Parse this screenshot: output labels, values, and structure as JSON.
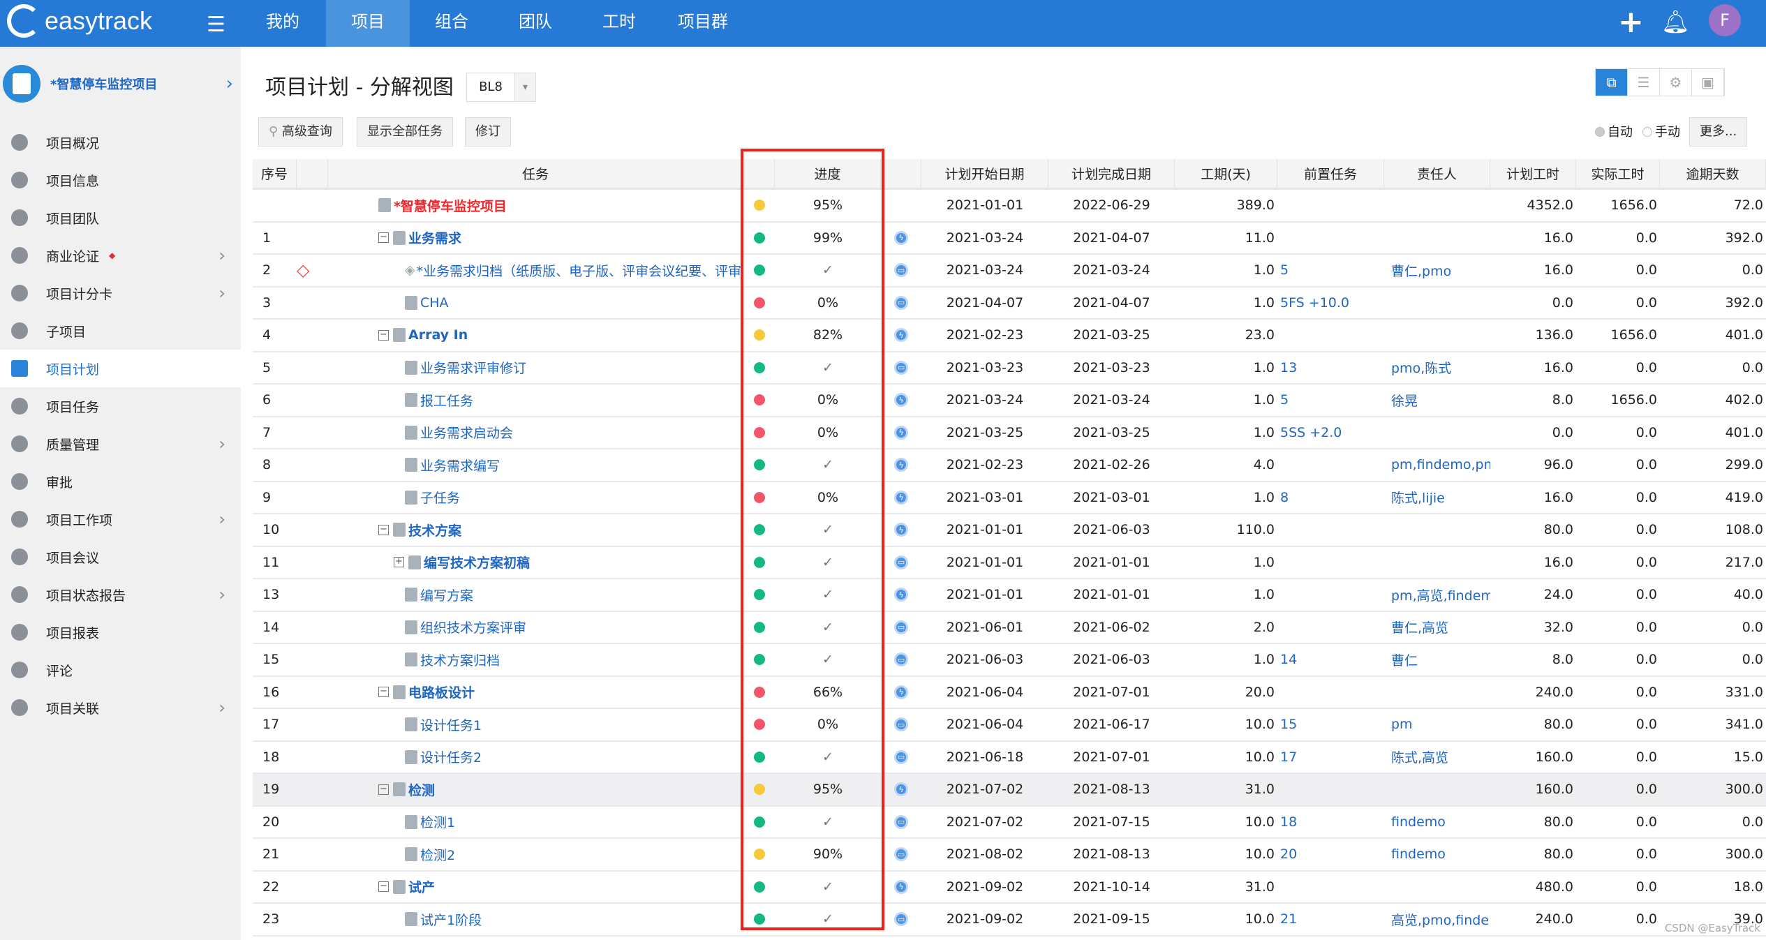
{
  "topbar": {
    "logo": "easytrack",
    "nav": [
      "我的",
      "项目",
      "组合",
      "团队",
      "工时",
      "项目群"
    ],
    "active_nav": 1,
    "avatar": "F",
    "brand_color": "#2679d4"
  },
  "sidebar": {
    "project": "*智慧停车监控项目",
    "items": [
      {
        "label": "项目概况"
      },
      {
        "label": "项目信息"
      },
      {
        "label": "项目团队"
      },
      {
        "label": "商业论证",
        "marker": "◆",
        "chevron": true
      },
      {
        "label": "项目计分卡",
        "chevron": true
      },
      {
        "label": "子项目"
      },
      {
        "label": "项目计划",
        "active": true
      },
      {
        "label": "项目任务"
      },
      {
        "label": "质量管理",
        "chevron": true
      },
      {
        "label": "审批"
      },
      {
        "label": "项目工作项",
        "chevron": true
      },
      {
        "label": "项目会议"
      },
      {
        "label": "项目状态报告",
        "chevron": true
      },
      {
        "label": "项目报表"
      },
      {
        "label": "评论"
      },
      {
        "label": "项目关联",
        "chevron": true
      }
    ]
  },
  "page": {
    "title": "项目计划 - 分解视图",
    "baseline": "BL8",
    "search_btn": "高级查询",
    "show_all_btn": "显示全部任务",
    "revise_btn": "修订",
    "radio_auto": "自动",
    "radio_manual": "手动",
    "more_btn": "更多...",
    "watermark": "CSDN @EasyTrack"
  },
  "columns": {
    "seq": "序号",
    "task": "任务",
    "progress": "进度",
    "start": "计划开始日期",
    "end": "计划完成日期",
    "duration": "工期(天)",
    "pred": "前置任务",
    "owner": "责任人",
    "planned": "计划工时",
    "actual": "实际工时",
    "overdue": "逾期天数"
  },
  "status_colors": {
    "green": "#13b981",
    "red": "#f25668",
    "yellow": "#f9c93a"
  },
  "rows": [
    {
      "seq": "",
      "task": "*智慧停车监控项目",
      "level": 0,
      "type": "root",
      "status": "yellow",
      "progress": "95%",
      "icon": "",
      "start": "2021-01-01",
      "end": "2022-06-29",
      "duration": "389.0",
      "pred": "",
      "owner": "",
      "planned": "4352.0",
      "actual": "1656.0",
      "overdue": "72.0"
    },
    {
      "seq": "1",
      "task": "业务需求",
      "level": 1,
      "type": "parent",
      "status": "green",
      "progress": "99%",
      "icon": "lightning",
      "start": "2021-03-24",
      "end": "2021-04-07",
      "duration": "11.0",
      "pred": "",
      "owner": "",
      "planned": "16.0",
      "actual": "0.0",
      "overdue": "392.0"
    },
    {
      "seq": "2",
      "task": "*业务需求归档（纸质版、电子版、评审会议纪要、评审意见处理",
      "level": 2,
      "type": "milestone",
      "warning": true,
      "status": "green",
      "progress": "✓",
      "icon": "bag",
      "start": "2021-03-24",
      "end": "2021-03-24",
      "duration": "1.0",
      "pred": "5",
      "owner": "曹仁,pmo",
      "planned": "16.0",
      "actual": "0.0",
      "overdue": "0.0"
    },
    {
      "seq": "3",
      "task": "CHA",
      "level": 2,
      "type": "task",
      "status": "red",
      "progress": "0%",
      "icon": "bag",
      "start": "2021-04-07",
      "end": "2021-04-07",
      "duration": "1.0",
      "pred": "5FS +10.0",
      "owner": "",
      "planned": "0.0",
      "actual": "0.0",
      "overdue": "392.0"
    },
    {
      "seq": "4",
      "task": "Array In",
      "level": 1,
      "type": "parent",
      "status": "yellow",
      "progress": "82%",
      "icon": "lightning",
      "start": "2021-02-23",
      "end": "2021-03-25",
      "duration": "23.0",
      "pred": "",
      "owner": "",
      "planned": "136.0",
      "actual": "1656.0",
      "overdue": "401.0"
    },
    {
      "seq": "5",
      "task": "业务需求评审修订",
      "level": 2,
      "type": "task",
      "status": "green",
      "progress": "✓",
      "icon": "bag",
      "start": "2021-03-23",
      "end": "2021-03-23",
      "duration": "1.0",
      "pred": "13",
      "owner": "pmo,陈式",
      "planned": "16.0",
      "actual": "0.0",
      "overdue": "0.0"
    },
    {
      "seq": "6",
      "task": "报工任务",
      "level": 2,
      "type": "task",
      "status": "red",
      "progress": "0%",
      "icon": "lightning",
      "start": "2021-03-24",
      "end": "2021-03-24",
      "duration": "1.0",
      "pred": "5",
      "owner": "徐晃",
      "planned": "8.0",
      "actual": "1656.0",
      "overdue": "402.0"
    },
    {
      "seq": "7",
      "task": "业务需求启动会",
      "level": 2,
      "type": "task",
      "status": "red",
      "progress": "0%",
      "icon": "lightning",
      "start": "2021-03-25",
      "end": "2021-03-25",
      "duration": "1.0",
      "pred": "5SS +2.0",
      "owner": "",
      "planned": "0.0",
      "actual": "0.0",
      "overdue": "401.0"
    },
    {
      "seq": "8",
      "task": "业务需求编写",
      "level": 2,
      "type": "task",
      "status": "green",
      "progress": "✓",
      "icon": "lightning",
      "start": "2021-02-23",
      "end": "2021-02-26",
      "duration": "4.0",
      "pred": "",
      "owner": "pm,findemo,pmo",
      "planned": "96.0",
      "actual": "0.0",
      "overdue": "299.0"
    },
    {
      "seq": "9",
      "task": "子任务",
      "level": 2,
      "type": "task",
      "status": "red",
      "progress": "0%",
      "icon": "lightning",
      "start": "2021-03-01",
      "end": "2021-03-01",
      "duration": "1.0",
      "pred": "8",
      "owner": "陈式,lijie",
      "planned": "16.0",
      "actual": "0.0",
      "overdue": "419.0"
    },
    {
      "seq": "10",
      "task": "技术方案",
      "level": 1,
      "type": "parent",
      "status": "green",
      "progress": "✓",
      "icon": "lightning",
      "start": "2021-01-01",
      "end": "2021-06-03",
      "duration": "110.0",
      "pred": "",
      "owner": "",
      "planned": "80.0",
      "actual": "0.0",
      "overdue": "108.0"
    },
    {
      "seq": "11",
      "task": "编写技术方案初稿",
      "level": 2,
      "type": "parent",
      "collapsed": true,
      "status": "green",
      "progress": "✓",
      "icon": "bag",
      "start": "2021-01-01",
      "end": "2021-01-01",
      "duration": "1.0",
      "pred": "",
      "owner": "",
      "planned": "16.0",
      "actual": "0.0",
      "overdue": "217.0"
    },
    {
      "seq": "13",
      "task": "编写方案",
      "level": 2,
      "type": "task",
      "status": "green",
      "progress": "✓",
      "icon": "lightning",
      "start": "2021-01-01",
      "end": "2021-01-01",
      "duration": "1.0",
      "pred": "",
      "owner": "pm,高览,findemo",
      "planned": "24.0",
      "actual": "0.0",
      "overdue": "40.0"
    },
    {
      "seq": "14",
      "task": "组织技术方案评审",
      "level": 2,
      "type": "task",
      "status": "green",
      "progress": "✓",
      "icon": "bag",
      "start": "2021-06-01",
      "end": "2021-06-02",
      "duration": "2.0",
      "pred": "",
      "owner": "曹仁,高览",
      "planned": "32.0",
      "actual": "0.0",
      "overdue": "0.0"
    },
    {
      "seq": "15",
      "task": "技术方案归档",
      "level": 2,
      "type": "task",
      "status": "green",
      "progress": "✓",
      "icon": "bag",
      "start": "2021-06-03",
      "end": "2021-06-03",
      "duration": "1.0",
      "pred": "14",
      "owner": "曹仁",
      "planned": "8.0",
      "actual": "0.0",
      "overdue": "0.0"
    },
    {
      "seq": "16",
      "task": "电路板设计",
      "level": 1,
      "type": "parent",
      "status": "red",
      "progress": "66%",
      "icon": "lightning",
      "start": "2021-06-04",
      "end": "2021-07-01",
      "duration": "20.0",
      "pred": "",
      "owner": "",
      "planned": "240.0",
      "actual": "0.0",
      "overdue": "331.0"
    },
    {
      "seq": "17",
      "task": "设计任务1",
      "level": 2,
      "type": "task",
      "status": "red",
      "progress": "0%",
      "icon": "bag",
      "start": "2021-06-04",
      "end": "2021-06-17",
      "duration": "10.0",
      "pred": "15",
      "owner": "pm",
      "planned": "80.0",
      "actual": "0.0",
      "overdue": "341.0"
    },
    {
      "seq": "18",
      "task": "设计任务2",
      "level": 2,
      "type": "task",
      "status": "green",
      "progress": "✓",
      "icon": "bag",
      "start": "2021-06-18",
      "end": "2021-07-01",
      "duration": "10.0",
      "pred": "17",
      "owner": "陈式,高览",
      "planned": "160.0",
      "actual": "0.0",
      "overdue": "15.0"
    },
    {
      "seq": "19",
      "task": "检测",
      "level": 1,
      "type": "parent",
      "highlight": true,
      "status": "yellow",
      "progress": "95%",
      "icon": "lightning",
      "start": "2021-07-02",
      "end": "2021-08-13",
      "duration": "31.0",
      "pred": "",
      "owner": "",
      "planned": "160.0",
      "actual": "0.0",
      "overdue": "300.0"
    },
    {
      "seq": "20",
      "task": "检测1",
      "level": 2,
      "type": "task",
      "status": "green",
      "progress": "✓",
      "icon": "bag",
      "start": "2021-07-02",
      "end": "2021-07-15",
      "duration": "10.0",
      "pred": "18",
      "owner": "findemo",
      "planned": "80.0",
      "actual": "0.0",
      "overdue": "0.0"
    },
    {
      "seq": "21",
      "task": "检测2",
      "level": 2,
      "type": "task",
      "status": "yellow",
      "progress": "90%",
      "icon": "bag",
      "start": "2021-08-02",
      "end": "2021-08-13",
      "duration": "10.0",
      "pred": "20",
      "owner": "findemo",
      "planned": "80.0",
      "actual": "0.0",
      "overdue": "300.0"
    },
    {
      "seq": "22",
      "task": "试产",
      "level": 1,
      "type": "parent",
      "status": "green",
      "progress": "✓",
      "icon": "lightning",
      "start": "2021-09-02",
      "end": "2021-10-14",
      "duration": "31.0",
      "pred": "",
      "owner": "",
      "planned": "480.0",
      "actual": "0.0",
      "overdue": "18.0"
    },
    {
      "seq": "23",
      "task": "试产1阶段",
      "level": 2,
      "type": "task",
      "status": "green",
      "progress": "✓",
      "icon": "bag",
      "start": "2021-09-02",
      "end": "2021-09-15",
      "duration": "10.0",
      "pred": "21",
      "owner": "高览,pmo,finde...",
      "planned": "240.0",
      "actual": "0.0",
      "overdue": "39.0"
    }
  ]
}
